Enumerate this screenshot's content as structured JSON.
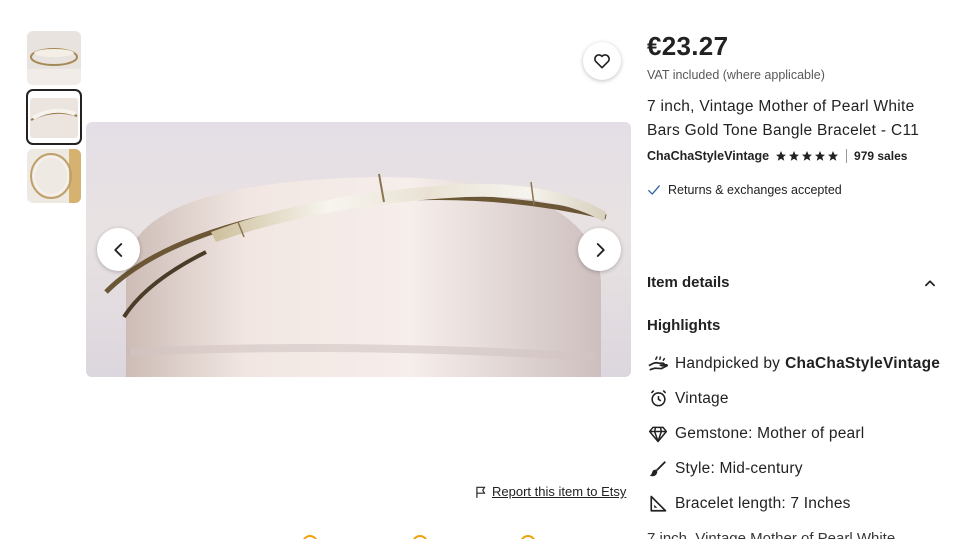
{
  "product": {
    "price": "€23.27",
    "vat_note": "VAT included (where applicable)",
    "title": "7 inch, Vintage Mother of Pearl White Bars Gold Tone Bangle Bracelet - C11",
    "shop_name": "ChaChaStyleVintage",
    "rating_stars": 5,
    "sales": "979 sales",
    "returns": "Returns & exchanges accepted"
  },
  "gallery": {
    "thumbnails": [
      "thumb-1",
      "thumb-2",
      "thumb-3"
    ],
    "active_index": 1,
    "report_label": "Report this item to Etsy"
  },
  "details": {
    "heading": "Item details",
    "highlights_heading": "Highlights",
    "items": [
      {
        "icon": "hand-icon",
        "text": "Handpicked by",
        "bold": "ChaChaStyleVintage"
      },
      {
        "icon": "clock-icon",
        "text": "Vintage",
        "bold": ""
      },
      {
        "icon": "gem-icon",
        "text": "Gemstone: Mother of pearl",
        "bold": ""
      },
      {
        "icon": "brush-icon",
        "text": "Style: Mid-century",
        "bold": ""
      },
      {
        "icon": "ruler-icon",
        "text": "Bracelet length: 7 Inches",
        "bold": ""
      }
    ],
    "cutoff_text": "7 inch, Vintage Mother of Pearl White"
  },
  "colors": {
    "text": "#222222",
    "muted": "#595959",
    "accent_check": "#2f5fa8"
  }
}
